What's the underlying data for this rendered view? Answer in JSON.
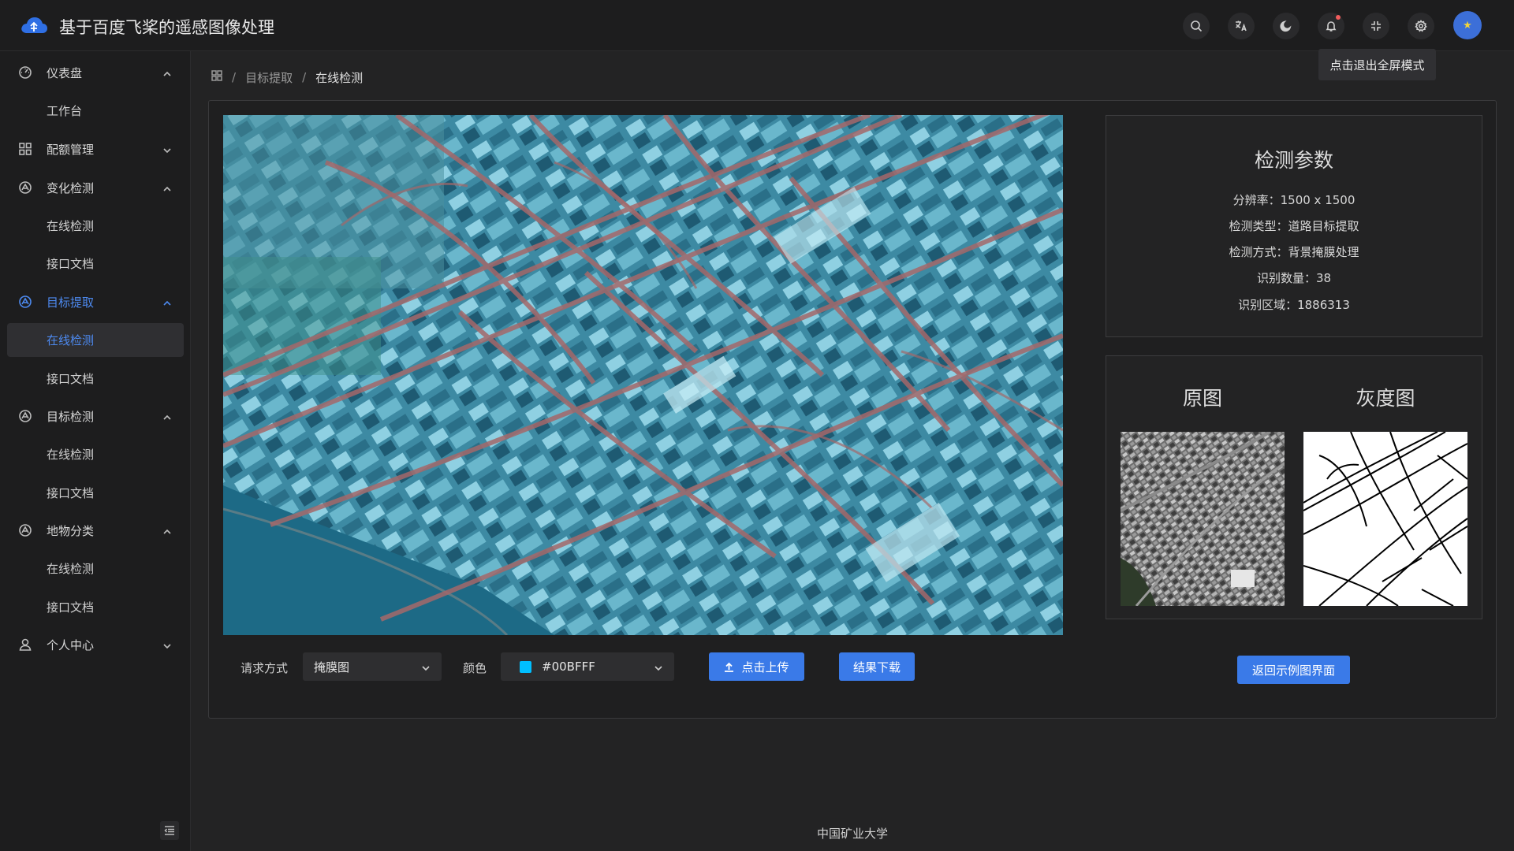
{
  "header": {
    "title": "基于百度飞桨的遥感图像处理",
    "tooltip": "点击退出全屏模式",
    "icons": [
      "search-icon",
      "translate-icon",
      "moon-icon",
      "bell-icon",
      "fullscreen-exit-icon",
      "gear-icon"
    ]
  },
  "sidebar": {
    "dashboard": "仪表盘",
    "workbench": "工作台",
    "quota": "配额管理",
    "change_detection": "变化检测",
    "change_online": "在线检测",
    "change_docs": "接口文档",
    "target_extraction": "目标提取",
    "extract_online": "在线检测",
    "extract_docs": "接口文档",
    "target_detection": "目标检测",
    "detect_online": "在线检测",
    "detect_docs": "接口文档",
    "classification": "地物分类",
    "classify_online": "在线检测",
    "classify_docs": "接口文档",
    "profile": "个人中心"
  },
  "breadcrumb": {
    "level1": "目标提取",
    "level2": "在线检测",
    "separator": "/"
  },
  "controls": {
    "request_label": "请求方式",
    "request_value": "掩膜图",
    "color_label": "颜色",
    "color_value": "#00BFFF",
    "upload_label": "点击上传",
    "download_label": "结果下载"
  },
  "params": {
    "title": "检测参数",
    "resolution": "分辨率：1500 x 1500",
    "type": "检测类型：道路目标提取",
    "method": "检测方式：背景掩膜处理",
    "count": "识别数量：38",
    "area": "识别区域：1886313"
  },
  "thumbs": {
    "original_title": "原图",
    "gray_title": "灰度图"
  },
  "back_button": "返回示例图界面",
  "footer": "中国矿业大学",
  "colors": {
    "accent": "#3a7ae8",
    "active_menu": "#4d8af0",
    "mask": "#00BFFF"
  }
}
